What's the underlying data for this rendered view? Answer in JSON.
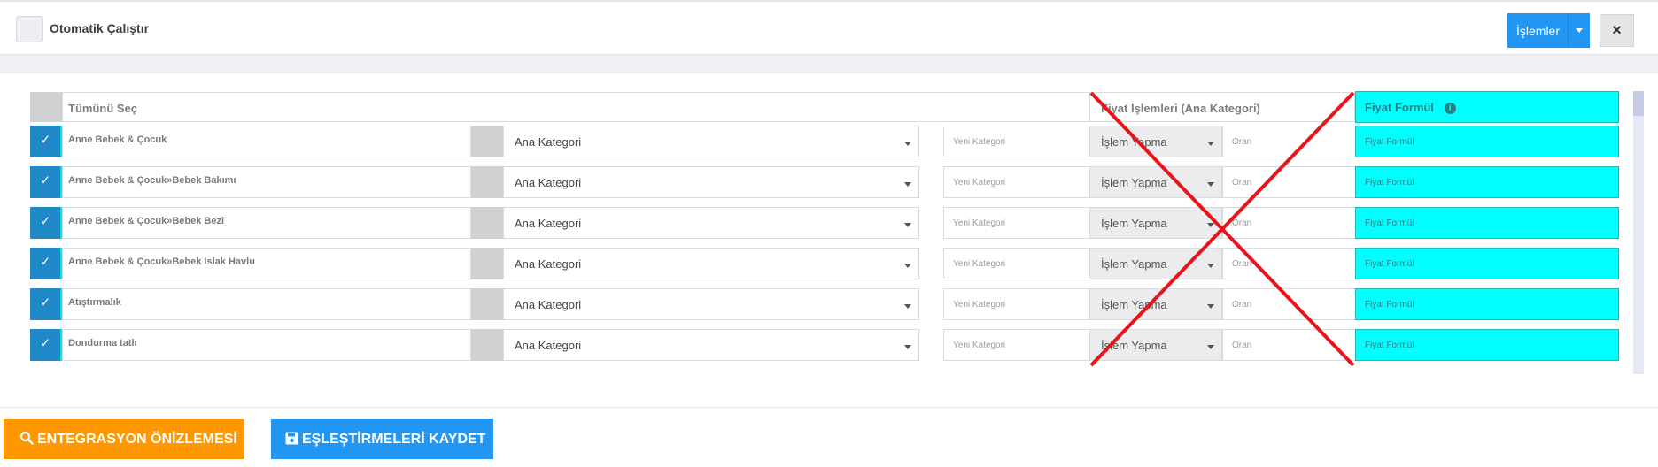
{
  "topbar": {
    "auto_run_label": "Otomatik Çalıştır",
    "operations_label": "İşlemler",
    "close_label": "×"
  },
  "table": {
    "select_all_label": "Tümünü Seç",
    "price_ops_header": "Fiyat İşlemleri (Ana Kategori)",
    "price_formula_header": "Fiyat Formül",
    "rows": [
      {
        "name": "Anne Bebek & Çocuk",
        "category": "Ana Kategori",
        "new_category_placeholder": "Yeni Kategori",
        "operation": "İşlem Yapma",
        "rate_placeholder": "Oran",
        "formula_placeholder": "Fiyat Formül"
      },
      {
        "name": "Anne Bebek & Çocuk»Bebek Bakımı",
        "category": "Ana Kategori",
        "new_category_placeholder": "Yeni Kategori",
        "operation": "İşlem Yapma",
        "rate_placeholder": "Oran",
        "formula_placeholder": "Fiyat Formül"
      },
      {
        "name": "Anne Bebek & Çocuk»Bebek Bezi",
        "category": "Ana Kategori",
        "new_category_placeholder": "Yeni Kategori",
        "operation": "İşlem Yapma",
        "rate_placeholder": "Oran",
        "formula_placeholder": "Fiyat Formül"
      },
      {
        "name": "Anne Bebek & Çocuk»Bebek Islak Havlu",
        "category": "Ana Kategori",
        "new_category_placeholder": "Yeni Kategori",
        "operation": "İşlem Yapma",
        "rate_placeholder": "Oran",
        "formula_placeholder": "Fiyat Formül"
      },
      {
        "name": "Atıştırmalık",
        "category": "Ana Kategori",
        "new_category_placeholder": "Yeni Kategori",
        "operation": "İşlem Yapma",
        "rate_placeholder": "Oran",
        "formula_placeholder": "Fiyat Formül"
      },
      {
        "name": "Dondurma tatlı",
        "category": "Ana Kategori",
        "new_category_placeholder": "Yeni Kategori",
        "operation": "İşlem Yapma",
        "rate_placeholder": "Oran",
        "formula_placeholder": "Fiyat Formül"
      }
    ]
  },
  "footer": {
    "preview_label": "ENTEGRASYON ÖNİZLEMESİ",
    "save_label": "EŞLEŞTİRMELERİ KAYDET"
  },
  "colors": {
    "primary": "#2196f3",
    "orange": "#ff9800",
    "formula_column": "#00ffff",
    "cross_overlay": "#e8141b"
  },
  "icons": {
    "preview": "search-icon",
    "save": "floppy-disk-icon",
    "dropdown": "caret-down-icon",
    "info": "info-circle-icon",
    "checkbox": "check-icon"
  }
}
